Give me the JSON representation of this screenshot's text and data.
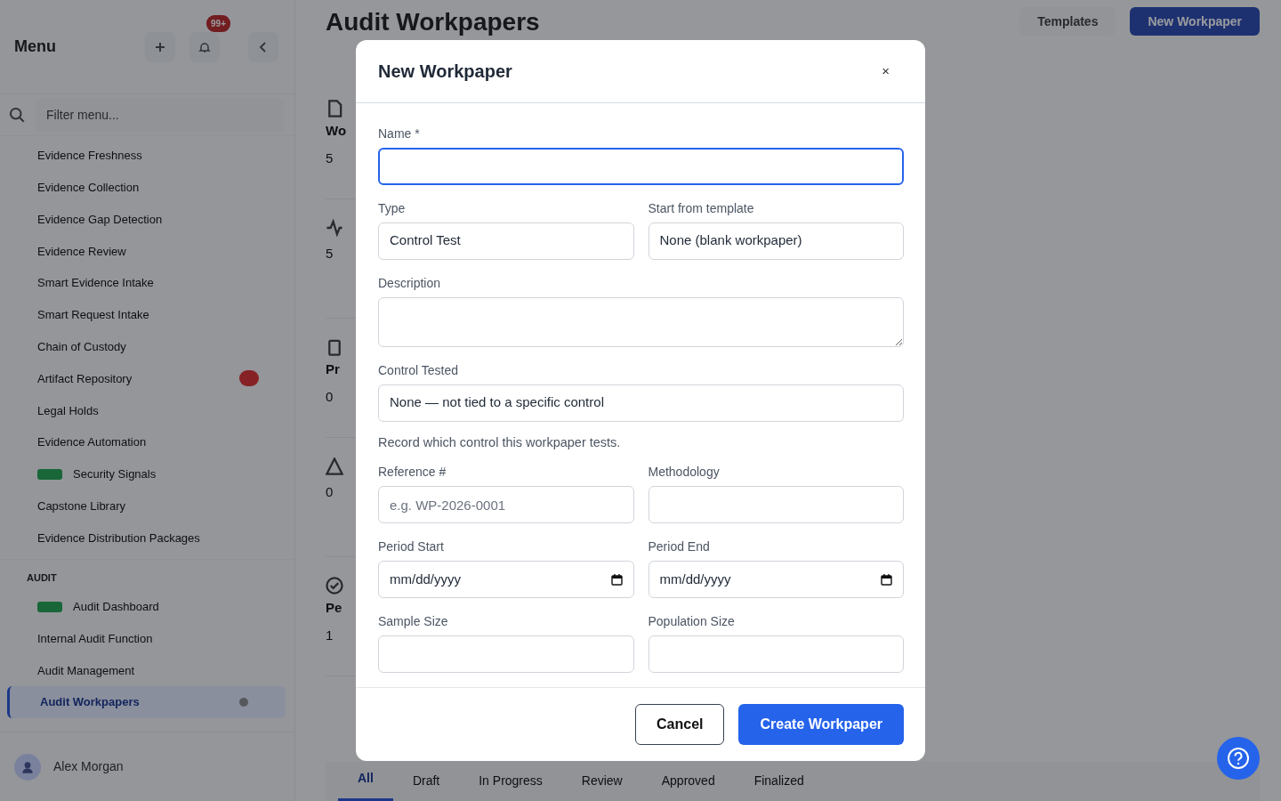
{
  "sidebar": {
    "title": "Menu",
    "notification_badge": "99+",
    "filter": {
      "placeholder": "Filter menu..."
    },
    "items": [
      {
        "label": "Evidence Freshness",
        "tag": false,
        "alert": false,
        "selected": false
      },
      {
        "label": "Evidence Collection",
        "tag": false,
        "alert": false,
        "selected": false
      },
      {
        "label": "Evidence Gap Detection",
        "tag": false,
        "alert": false,
        "selected": false
      },
      {
        "label": "Evidence Review",
        "tag": false,
        "alert": false,
        "selected": false
      },
      {
        "label": "Smart Evidence Intake",
        "tag": false,
        "alert": false,
        "selected": false
      },
      {
        "label": "Smart Request Intake",
        "tag": false,
        "alert": false,
        "selected": false
      },
      {
        "label": "Chain of Custody",
        "tag": false,
        "alert": false,
        "selected": false
      },
      {
        "label": "Artifact Repository",
        "tag": false,
        "alert": true,
        "selected": false
      },
      {
        "label": "Legal Holds",
        "tag": false,
        "alert": false,
        "selected": false
      },
      {
        "label": "Evidence Automation",
        "tag": false,
        "alert": false,
        "selected": false
      },
      {
        "label": "Security Signals",
        "tag": true,
        "alert": false,
        "selected": false
      },
      {
        "label": "Capstone Library",
        "tag": false,
        "alert": false,
        "selected": false
      },
      {
        "label": "Evidence Distribution Packages",
        "tag": false,
        "alert": false,
        "selected": false
      }
    ],
    "section": {
      "title": "AUDIT",
      "items": [
        {
          "label": "Audit Dashboard",
          "tag": true,
          "alert": false,
          "selected": false
        },
        {
          "label": "Internal Audit Function",
          "tag": false,
          "alert": false,
          "selected": false
        },
        {
          "label": "Audit Management",
          "tag": false,
          "alert": false,
          "selected": false
        },
        {
          "label": "Audit Workpapers",
          "tag": false,
          "alert": false,
          "selected": true
        }
      ]
    },
    "user": {
      "name": "Alex Morgan"
    }
  },
  "page": {
    "title": "Audit Workpapers",
    "buttons": [
      {
        "label": "Templates",
        "kind": "secondary"
      },
      {
        "label": "New Workpaper",
        "kind": "primary"
      }
    ],
    "stats": [
      {
        "label": "Wo",
        "value": "5"
      },
      {
        "value": "5"
      },
      {
        "label": "Pr",
        "value": "0"
      },
      {
        "value": "0"
      },
      {
        "label": "Pe",
        "value": "1"
      }
    ],
    "tabs": [
      {
        "label": "All",
        "selected": true
      },
      {
        "label": "Draft",
        "selected": false
      },
      {
        "label": "In Progress",
        "selected": false
      },
      {
        "label": "Review",
        "selected": false
      },
      {
        "label": "Approved",
        "selected": false
      },
      {
        "label": "Finalized",
        "selected": false
      }
    ]
  },
  "dialog": {
    "title": "New Workpaper",
    "close": "×",
    "fields": [
      {
        "kind": "text",
        "label": "Name *",
        "wide": true,
        "focused": true
      },
      {
        "kind": "select",
        "label": "Type",
        "value": "Control Test",
        "wide": false,
        "focused": false
      },
      {
        "kind": "select",
        "label": "Start from template",
        "value": "None (blank workpaper)",
        "wide": false,
        "focused": false
      },
      {
        "kind": "textarea",
        "label": "Description",
        "wide": true,
        "focused": false
      },
      {
        "kind": "select",
        "label": "Control Tested",
        "value": "None — not tied to a specific control",
        "help": "Record which control this workpaper tests.",
        "wide": true,
        "focused": false
      },
      {
        "kind": "text",
        "label": "Reference #",
        "placeholder": "e.g. WP-2026-0001",
        "wide": false,
        "focused": false
      },
      {
        "kind": "text",
        "label": "Methodology",
        "wide": false,
        "focused": false
      },
      {
        "kind": "date",
        "label": "Period Start",
        "value": "mm/dd/yyyy",
        "wide": false,
        "focused": false
      },
      {
        "kind": "date",
        "label": "Period End",
        "value": "mm/dd/yyyy",
        "wide": false,
        "focused": false
      },
      {
        "kind": "text",
        "label": "Sample Size",
        "wide": false,
        "focused": false
      },
      {
        "kind": "text",
        "label": "Population Size",
        "wide": false,
        "focused": false
      }
    ],
    "buttons": [
      {
        "label": "Cancel",
        "kind": "secondary"
      },
      {
        "label": "Create Workpaper",
        "kind": "primary"
      }
    ]
  }
}
